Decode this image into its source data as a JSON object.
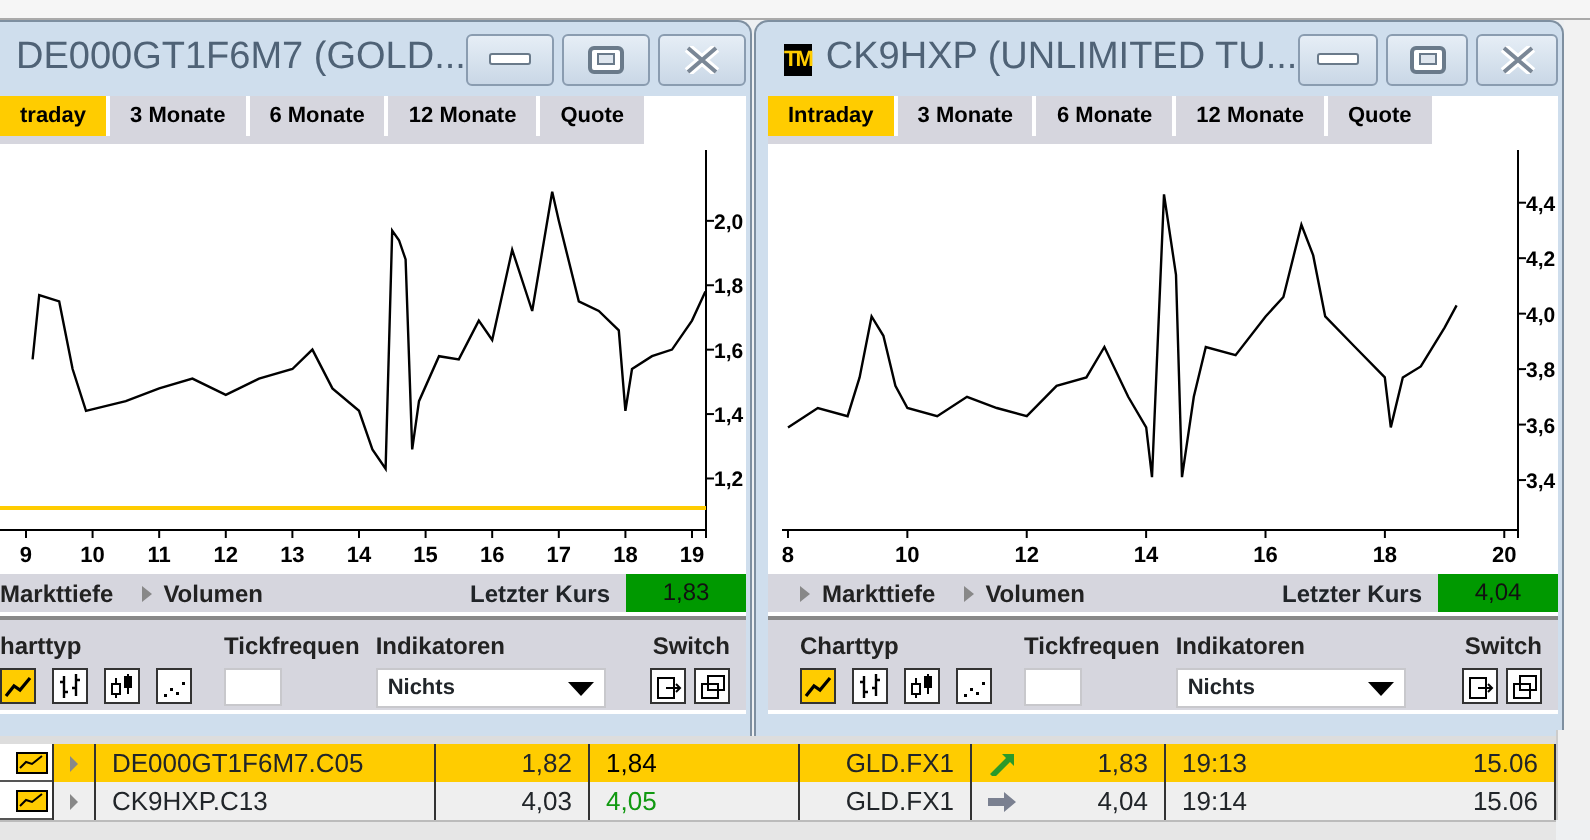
{
  "windows": [
    {
      "title": "DE000GT1F6M7 (GOLD...",
      "tabs": [
        {
          "label": "traday",
          "selected": true
        },
        {
          "label": "3 Monate",
          "selected": false
        },
        {
          "label": "6 Monate",
          "selected": false
        },
        {
          "label": "12 Monate",
          "selected": false
        },
        {
          "label": "Quote",
          "selected": false
        }
      ],
      "chart_data": {
        "type": "line",
        "x": [
          9.1,
          9.2,
          9.5,
          9.7,
          9.9,
          10.5,
          11,
          11.5,
          12,
          12.5,
          13,
          13.3,
          13.6,
          14,
          14.2,
          14.4,
          14.5,
          14.6,
          14.7,
          14.8,
          14.9,
          15.2,
          15.5,
          15.8,
          16,
          16.3,
          16.6,
          16.9,
          17,
          17.3,
          17.6,
          17.9,
          18,
          18.1,
          18.4,
          18.7,
          19,
          19.2
        ],
        "values": [
          1.57,
          1.77,
          1.75,
          1.54,
          1.41,
          1.44,
          1.48,
          1.51,
          1.46,
          1.51,
          1.54,
          1.6,
          1.48,
          1.41,
          1.29,
          1.23,
          1.97,
          1.94,
          1.88,
          1.29,
          1.44,
          1.58,
          1.57,
          1.69,
          1.63,
          1.91,
          1.72,
          2.09,
          2.0,
          1.75,
          1.72,
          1.66,
          1.41,
          1.54,
          1.58,
          1.6,
          1.69,
          1.78
        ],
        "xlim": [
          8.61,
          19.21
        ],
        "ylim": [
          1.04,
          2.22
        ],
        "xticks": [
          9,
          10,
          11,
          12,
          13,
          14,
          15,
          16,
          17,
          18,
          19
        ],
        "yticks": [
          {
            "value": 1.2,
            "label": "1,2"
          },
          {
            "value": 1.4,
            "label": "1,4"
          },
          {
            "value": 1.6,
            "label": "1,6"
          },
          {
            "value": 1.8,
            "label": "1,8"
          },
          {
            "value": 2.0,
            "label": "2,0"
          }
        ]
      },
      "reference_line": true,
      "footer": {
        "links": [
          {
            "label": "Markttiefe",
            "expander": false
          },
          {
            "label": "Volumen",
            "expander": true
          }
        ],
        "last_price_label": "Letzter Kurs",
        "last_price": "1,83"
      },
      "toolbar": {
        "chart_type_label": "harttyp",
        "chart_types": [
          {
            "kind": "line",
            "selected": true
          },
          {
            "kind": "ohlc",
            "selected": false
          },
          {
            "kind": "candle",
            "selected": false
          },
          {
            "kind": "dots",
            "selected": false
          }
        ],
        "tick_label": "Tickfrequen",
        "indicator_label": "Indikatoren",
        "indicator": "Nichts",
        "switch_label": "Switch",
        "switch_buttons": [
          {
            "kind": "detach"
          },
          {
            "kind": "restore"
          }
        ]
      }
    },
    {
      "logo": "TM",
      "title": "CK9HXP (UNLIMITED TU...",
      "tabs": [
        {
          "label": "Intraday",
          "selected": true
        },
        {
          "label": "3 Monate",
          "selected": false
        },
        {
          "label": "6 Monate",
          "selected": false
        },
        {
          "label": "12 Monate",
          "selected": false
        },
        {
          "label": "Quote",
          "selected": false
        }
      ],
      "chart_data": {
        "type": "line",
        "x": [
          8,
          8.5,
          9,
          9.2,
          9.4,
          9.6,
          9.8,
          10,
          10.5,
          11,
          11.5,
          12,
          12.5,
          13,
          13.3,
          13.7,
          14,
          14.1,
          14.3,
          14.5,
          14.6,
          14.8,
          15,
          15.5,
          16,
          16.3,
          16.6,
          16.8,
          17,
          17.5,
          18,
          18.1,
          18.3,
          18.6,
          19,
          19.2
        ],
        "values": [
          3.59,
          3.66,
          3.63,
          3.77,
          3.99,
          3.92,
          3.74,
          3.66,
          3.63,
          3.7,
          3.66,
          3.63,
          3.74,
          3.77,
          3.88,
          3.7,
          3.59,
          3.41,
          4.43,
          4.14,
          3.41,
          3.7,
          3.88,
          3.85,
          3.99,
          4.06,
          4.32,
          4.21,
          3.99,
          3.88,
          3.77,
          3.59,
          3.77,
          3.81,
          3.95,
          4.03
        ],
        "xlim": [
          7.9,
          20.23
        ],
        "ylim": [
          3.22,
          4.59
        ],
        "xticks": [
          8,
          10,
          12,
          14,
          16,
          18,
          20
        ],
        "yticks": [
          {
            "value": 3.4,
            "label": "3,4"
          },
          {
            "value": 3.6,
            "label": "3,6"
          },
          {
            "value": 3.8,
            "label": "3,8"
          },
          {
            "value": 4.0,
            "label": "4,0"
          },
          {
            "value": 4.2,
            "label": "4,2"
          },
          {
            "value": 4.4,
            "label": "4,4"
          }
        ]
      },
      "reference_line": false,
      "footer": {
        "links": [
          {
            "label": "Markttiefe",
            "expander": true
          },
          {
            "label": "Volumen",
            "expander": true
          }
        ],
        "last_price_label": "Letzter Kurs",
        "last_price": "4,04"
      },
      "toolbar": {
        "chart_type_label": "Charttyp",
        "chart_types": [
          {
            "kind": "line",
            "selected": true
          },
          {
            "kind": "ohlc",
            "selected": false
          },
          {
            "kind": "candle",
            "selected": false
          },
          {
            "kind": "dots",
            "selected": false
          }
        ],
        "tick_label": "Tickfrequen",
        "indicator_label": "Indikatoren",
        "indicator": "Nichts",
        "switch_label": "Switch",
        "switch_buttons": [
          {
            "kind": "detach"
          },
          {
            "kind": "restore"
          }
        ]
      }
    }
  ],
  "table": {
    "rows": [
      {
        "selected": true,
        "symbol": "DE000GT1F6M7.C05",
        "bid": "1,82",
        "ask": {
          "text": "1,84",
          "color": "#000000"
        },
        "exchange": "GLD.FX1",
        "trend_icon": {
          "kind": "up"
        },
        "last": "1,83",
        "time": "19:13",
        "date": "15.06"
      },
      {
        "selected": false,
        "symbol": "CK9HXP.C13",
        "bid": "4,03",
        "ask": {
          "text": "4,05",
          "color": "#119911"
        },
        "exchange": "GLD.FX1",
        "trend_icon": {
          "kind": "flat"
        },
        "last": "4,04",
        "time": "19:14",
        "date": "15.06"
      }
    ]
  }
}
